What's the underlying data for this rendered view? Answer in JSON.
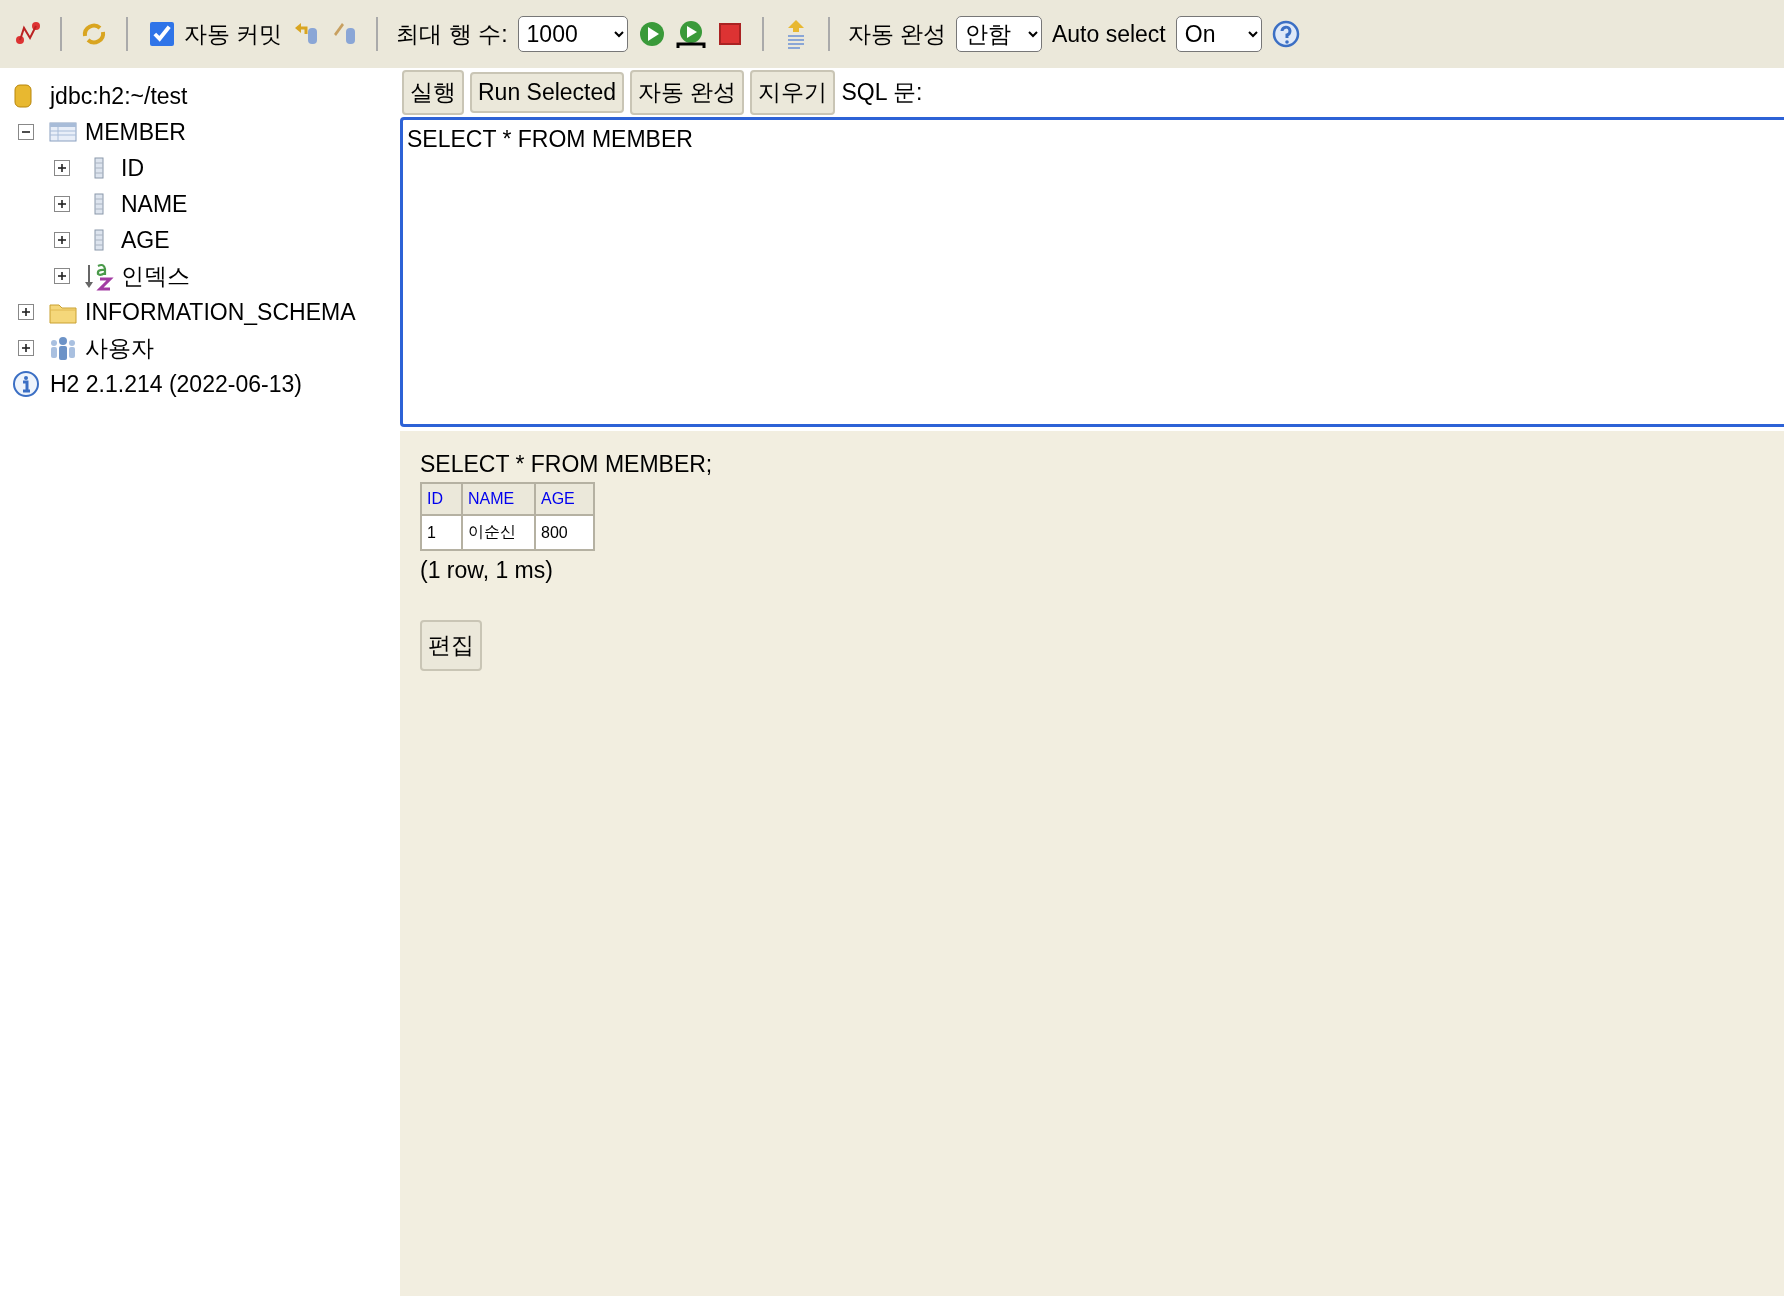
{
  "toolbar": {
    "autocommit": {
      "label": "자동 커밋",
      "checked": true
    },
    "max_rows": {
      "label": "최대 행 수:",
      "value": "1000"
    },
    "autocomplete": {
      "label": "자동 완성",
      "value": "안함"
    },
    "auto_select": {
      "label": "Auto select",
      "value": "On"
    }
  },
  "tree": [
    {
      "kind": "connection",
      "label": "jdbc:h2:~/test"
    },
    {
      "kind": "table",
      "label": "MEMBER",
      "expanded": true,
      "children": [
        {
          "kind": "column",
          "label": "ID",
          "expanded": false
        },
        {
          "kind": "column",
          "label": "NAME",
          "expanded": false
        },
        {
          "kind": "column",
          "label": "AGE",
          "expanded": false
        },
        {
          "kind": "index",
          "label": "인덱스",
          "expanded": false
        }
      ]
    },
    {
      "kind": "folder",
      "label": "INFORMATION_SCHEMA",
      "expanded": false
    },
    {
      "kind": "users",
      "label": "사용자",
      "expanded": false
    },
    {
      "kind": "info",
      "label": "H2 2.1.214 (2022-06-13)"
    }
  ],
  "editor": {
    "buttons": [
      "실행",
      "Run Selected",
      "자동 완성",
      "지우기"
    ],
    "label": "SQL 문:",
    "value": "SELECT * FROM MEMBER"
  },
  "result": {
    "statement": "SELECT * FROM MEMBER;",
    "columns": [
      "ID",
      "NAME",
      "AGE"
    ],
    "rows": [
      [
        "1",
        "이순신",
        "800"
      ]
    ],
    "summary": "(1 row, 1 ms)",
    "edit_button": "편집"
  }
}
